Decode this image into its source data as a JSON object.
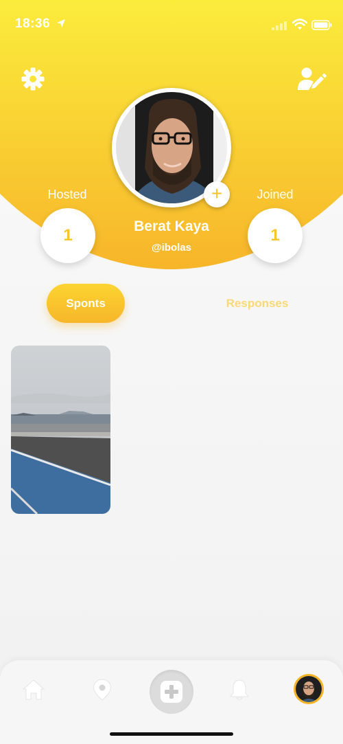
{
  "status": {
    "time": "18:36"
  },
  "profile": {
    "name": "Berat Kaya",
    "handle": "@ibolas",
    "hosted": {
      "label": "Hosted",
      "count": "1"
    },
    "joined": {
      "label": "Joined",
      "count": "1"
    },
    "add_photo_symbol": "+"
  },
  "tabs": [
    {
      "label": "Sponts",
      "active": true
    },
    {
      "label": "Responses",
      "active": false
    }
  ],
  "colors": {
    "accent": "#f9c12a",
    "accent_light": "#fbe73c",
    "accent_dark": "#f7b22a"
  },
  "icons": {
    "settings": "gear-icon",
    "edit_profile": "user-edit-icon",
    "nav": [
      "home-icon",
      "location-pin-icon",
      "add-icon",
      "bell-icon",
      "profile-avatar"
    ]
  }
}
